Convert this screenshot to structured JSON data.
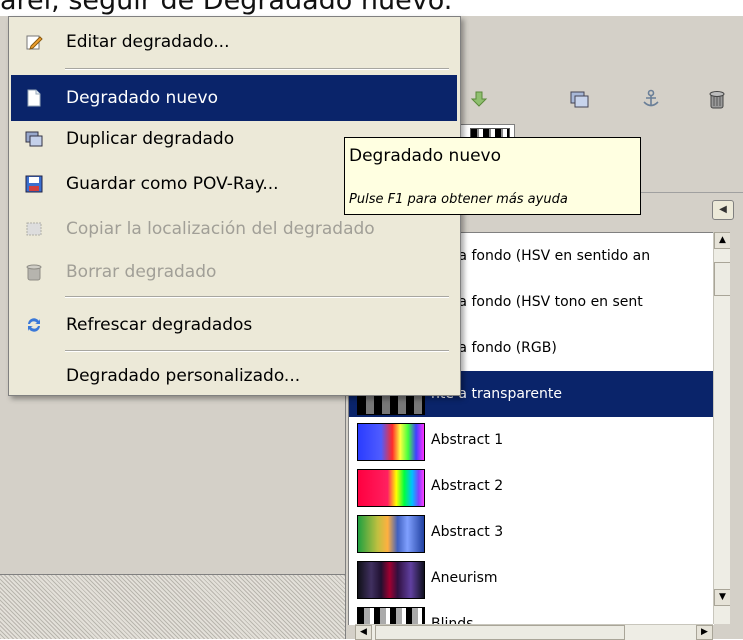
{
  "caption": "arel, seguir de Degradado nuevo.",
  "colors": {
    "selection": "#0a246a",
    "menu_bg": "#ece9d8",
    "tooltip_bg": "#ffffe1",
    "disabled_text": "#a19f97"
  },
  "menu": {
    "items": [
      {
        "label": "Editar degradado...",
        "icon": "edit-icon"
      },
      {
        "label": "Degradado nuevo",
        "icon": "new-document-icon"
      },
      {
        "label": "Duplicar degradado",
        "icon": "duplicate-icon"
      },
      {
        "label": "Guardar como POV-Ray...",
        "icon": "save-povray-icon"
      },
      {
        "label": "Copiar la localización del degradado",
        "icon": "copy-location-icon"
      },
      {
        "label": "Borrar degradado",
        "icon": "trash-icon"
      },
      {
        "label": "Refrescar degradados",
        "icon": "refresh-icon"
      },
      {
        "label": "Degradado personalizado...",
        "icon": ""
      }
    ]
  },
  "tooltip": {
    "title": "Degradado nuevo",
    "help": "Pulse F1 para obtener más ayuda"
  },
  "gradient_list": {
    "rows": [
      {
        "label": "nte a fondo (HSV en sentido an",
        "swatch": "fg-bg-hsv-ccw"
      },
      {
        "label": "nte a fondo (HSV tono en sent",
        "swatch": "fg-bg-hsv-cw"
      },
      {
        "label": "nte a fondo (RGB)",
        "swatch": "fg-bg-rgb"
      },
      {
        "label": "nte a transparente",
        "swatch": "fg-transparent"
      },
      {
        "label": "Abstract 1",
        "swatch": "abstract-1"
      },
      {
        "label": "Abstract 2",
        "swatch": "abstract-2"
      },
      {
        "label": "Abstract 3",
        "swatch": "abstract-3"
      },
      {
        "label": "Aneurism",
        "swatch": "aneurism"
      },
      {
        "label": "Blinds",
        "swatch": "blinds"
      }
    ],
    "selected_index": 3
  },
  "toolbar": {
    "icons": [
      "import-arrow-icon",
      "duplicate-icon",
      "anchor-icon",
      "delete-icon"
    ]
  }
}
